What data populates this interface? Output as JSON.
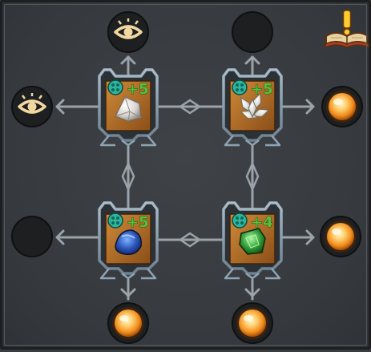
{
  "board": {
    "quest_book_icon": "book-exclamation-icon",
    "slots": [
      {
        "name": "slot-top-left",
        "bonus": "+5",
        "gem": "white-crystal"
      },
      {
        "name": "slot-top-right",
        "bonus": "+5",
        "gem": "pale-crystal-cluster"
      },
      {
        "name": "slot-bottom-left",
        "bonus": "+5",
        "gem": "blue-crystal"
      },
      {
        "name": "slot-bottom-right",
        "bonus": "+4",
        "gem": "green-crystal"
      }
    ],
    "endpoints": [
      {
        "name": "top-left-outlet",
        "state": "eye"
      },
      {
        "name": "top-right-outlet",
        "state": "empty"
      },
      {
        "name": "left-top-outlet",
        "state": "eye"
      },
      {
        "name": "left-bottom-outlet",
        "state": "empty"
      },
      {
        "name": "right-top-outlet",
        "state": "orb"
      },
      {
        "name": "right-bottom-outlet",
        "state": "orb"
      },
      {
        "name": "bottom-left-outlet",
        "state": "orb"
      },
      {
        "name": "bottom-right-outlet",
        "state": "orb"
      }
    ],
    "colors": {
      "connector": "#9aa3aa",
      "slot_frame": "#8fa3b3",
      "slot_fill": "#b8762c",
      "bonus_text": "#55c23a",
      "orb": "#ffb347",
      "eye": "#f2d8a0"
    }
  }
}
